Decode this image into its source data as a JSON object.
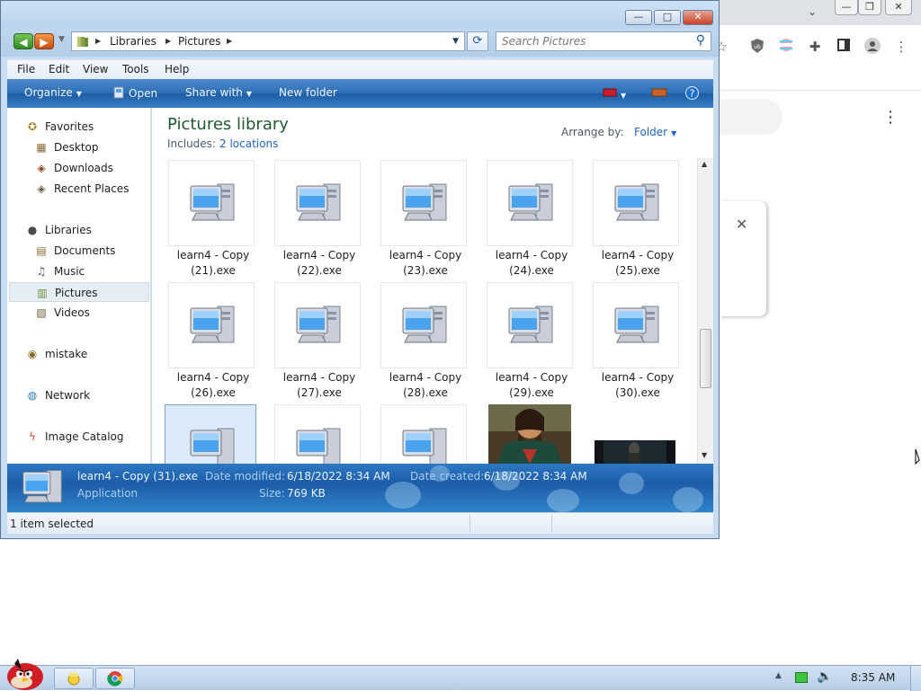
{
  "explorer": {
    "title_controls": {
      "minimize": "—",
      "maximize": "□",
      "close": "✕"
    },
    "nav": {
      "back": "◀",
      "forward": "▶",
      "breadcrumbs": [
        "Libraries",
        "Pictures"
      ],
      "search_placeholder": "Search Pictures"
    },
    "menu": [
      "File",
      "Edit",
      "View",
      "Tools",
      "Help"
    ],
    "commands": {
      "organize": "Organize",
      "open": "Open",
      "share_with": "Share with",
      "new_folder": "New folder"
    },
    "sidebar": {
      "favorites": "Favorites",
      "desktop": "Desktop",
      "downloads": "Downloads",
      "recent_places": "Recent Places",
      "libraries": "Libraries",
      "documents": "Documents",
      "music": "Music",
      "pictures": "Pictures",
      "videos": "Videos",
      "mistake": "mistake",
      "network": "Network",
      "image_catalog": "Image Catalog"
    },
    "library": {
      "title": "Pictures library",
      "includes_label": "Includes:",
      "includes_link": "2 locations",
      "arrange_label": "Arrange by:",
      "arrange_value": "Folder"
    },
    "files": [
      {
        "line1": "learn4 - Copy",
        "line2": "(21).exe"
      },
      {
        "line1": "learn4 - Copy",
        "line2": "(22).exe"
      },
      {
        "line1": "learn4 - Copy",
        "line2": "(23).exe"
      },
      {
        "line1": "learn4 - Copy",
        "line2": "(24).exe"
      },
      {
        "line1": "learn4 - Copy",
        "line2": "(25).exe"
      },
      {
        "line1": "learn4 - Copy",
        "line2": "(26).exe"
      },
      {
        "line1": "learn4 - Copy",
        "line2": "(27).exe"
      },
      {
        "line1": "learn4 - Copy",
        "line2": "(28).exe"
      },
      {
        "line1": "learn4 - Copy",
        "line2": "(29).exe"
      },
      {
        "line1": "learn4 - Copy",
        "line2": "(30).exe"
      }
    ],
    "details": {
      "name": "learn4 - Copy (31).exe",
      "type": "Application",
      "modified_label": "Date modified:",
      "modified_value": "6/18/2022 8:34 AM",
      "size_label": "Size:",
      "size_value": "769 KB",
      "created_label": "Date created:",
      "created_value": "6/18/2022 8:34 AM"
    },
    "status": "1 item selected"
  },
  "taskbar": {
    "clock": "8:35 AM"
  },
  "colors": {
    "command_bar": "#1d5da8",
    "library_title": "#1e5a2e",
    "link": "#1e64c8",
    "selection": "#dcebfc"
  }
}
